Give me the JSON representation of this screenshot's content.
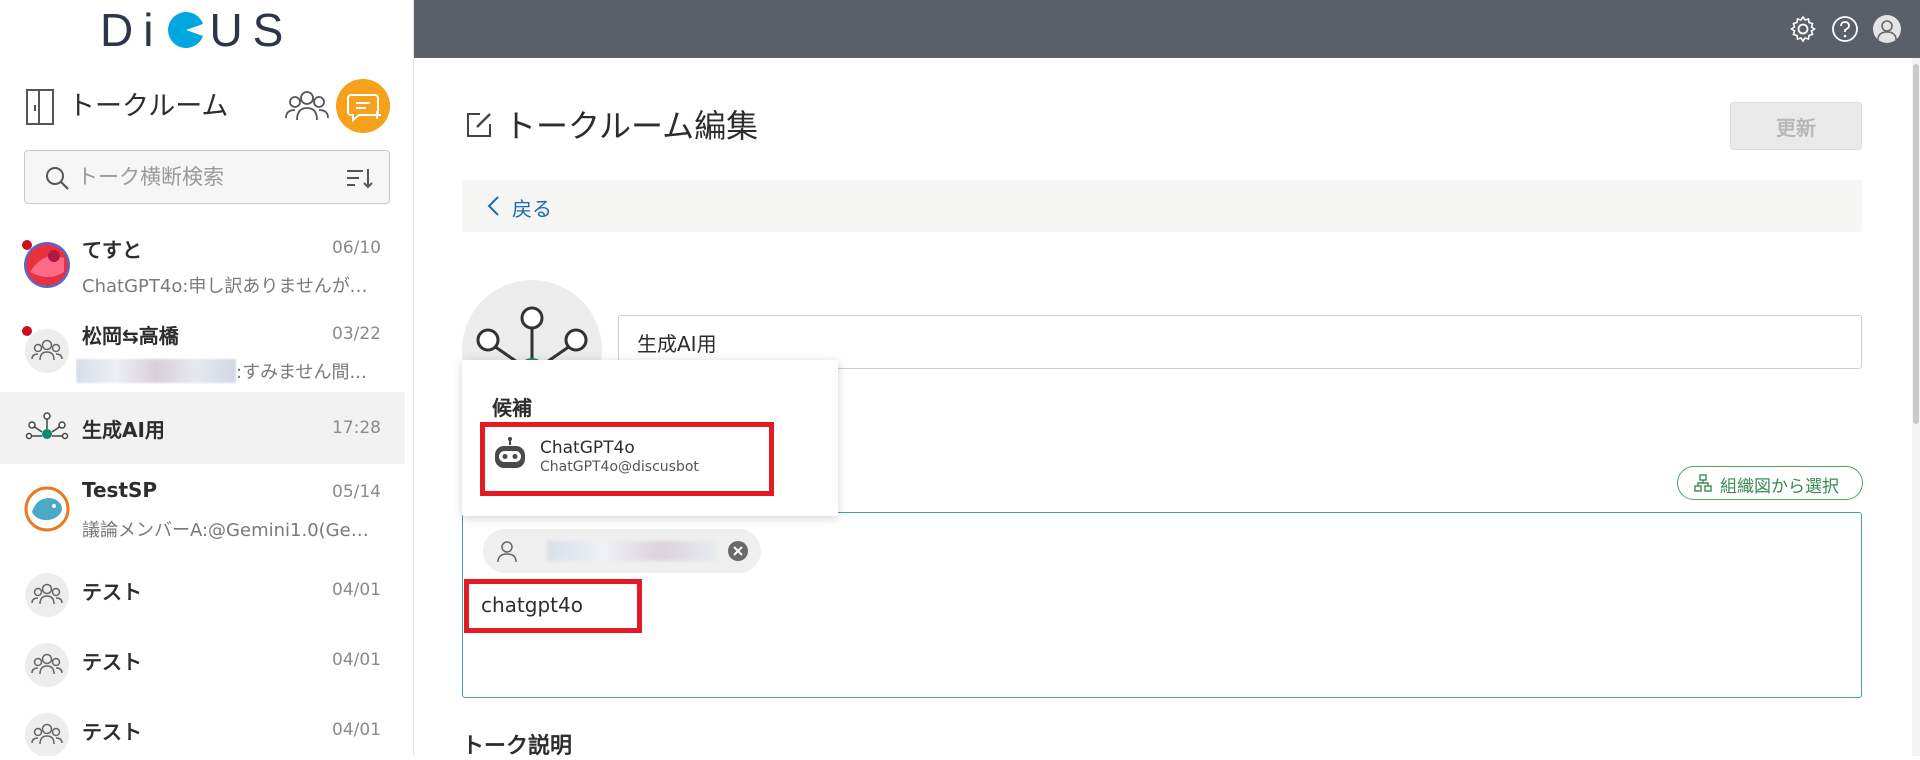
{
  "app": {
    "logo_left": "Di",
    "logo_right": "US",
    "brand_color": "#00a6e0",
    "accent_color": "#f5a11c",
    "topbar_color": "#5b5f67"
  },
  "sidebar": {
    "title": "トークルーム",
    "search": {
      "placeholder": "トーク横断検索"
    },
    "talks": [
      {
        "name": "てすと",
        "date": "06/10",
        "message": "ChatGPT4o:申し訳ありませんが、...",
        "unread": true
      },
      {
        "name": "松岡⇆高橋",
        "date": "03/22",
        "message": ":すみません間...",
        "unread": true
      },
      {
        "name": "生成AI用",
        "date": "17:28",
        "message": "",
        "selected": true
      },
      {
        "name": "TestSP",
        "date": "05/14",
        "message": "議論メンバーA:@Gemini1.0(Gemi..."
      },
      {
        "name": "テスト",
        "date": "04/01",
        "message": ""
      },
      {
        "name": "テスト",
        "date": "04/01",
        "message": ""
      },
      {
        "name": "テスト",
        "date": "04/01",
        "message": ""
      }
    ]
  },
  "topbar": {
    "icons": [
      "gear-icon",
      "help-icon",
      "user-icon"
    ]
  },
  "main": {
    "title": "トークルーム編集",
    "update_label": "更新",
    "back_label": "戻る",
    "room_name_value": "生成AI用",
    "org_select_label": "組織図から選択",
    "member_input_value": "chatgpt4o",
    "description_label": "トーク説明",
    "candidates": {
      "title": "候補",
      "items": [
        {
          "name": "ChatGPT4o",
          "id": "ChatGPT4o@discusbot"
        }
      ]
    }
  }
}
